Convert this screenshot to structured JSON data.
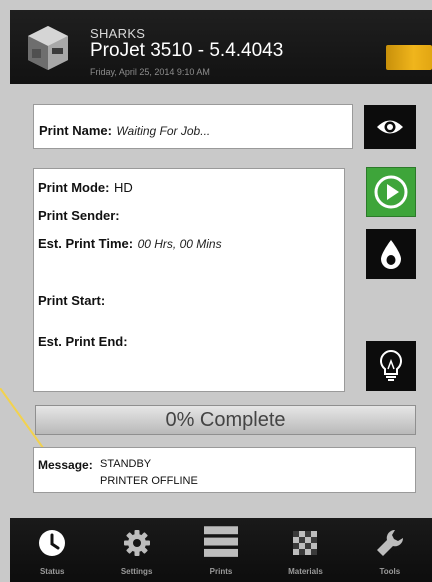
{
  "header": {
    "model_name": "SHARKS",
    "printer_title": "ProJet 3510 - 5.4.4043",
    "datetime": "Friday, April 25, 2014 9:10 AM",
    "status_lamp_color": "#f0b51c"
  },
  "print_name": {
    "label": "Print Name:",
    "value": "Waiting For Job..."
  },
  "details": {
    "mode_label": "Print Mode:",
    "mode_value": "HD",
    "sender_label": "Print Sender:",
    "sender_value": "",
    "time_label": "Est. Print Time:",
    "time_value": "00 Hrs, 00 Mins",
    "start_label": "Print Start:",
    "start_value": "",
    "end_label": "Est. Print End:",
    "end_value": ""
  },
  "side_buttons": {
    "preview": "eye-icon",
    "start": "play-icon",
    "materials": "drop-icon",
    "light": "bulb-icon",
    "start_color": "#3ea53a"
  },
  "progress": {
    "percent": 0,
    "text": "0% Complete"
  },
  "message": {
    "label": "Message:",
    "line1": "STANDBY",
    "line2": "PRINTER OFFLINE"
  },
  "nav": {
    "items": [
      {
        "label": "Status",
        "icon": "clock-icon"
      },
      {
        "label": "Settings",
        "icon": "gear-icon"
      },
      {
        "label": "Prints",
        "icon": "list-icon"
      },
      {
        "label": "Materials",
        "icon": "materials-icon"
      },
      {
        "label": "Tools",
        "icon": "wrench-icon"
      }
    ]
  },
  "colors": {
    "callout": "#f2d24e",
    "background": "#c9c9c9",
    "header": "#161616"
  }
}
